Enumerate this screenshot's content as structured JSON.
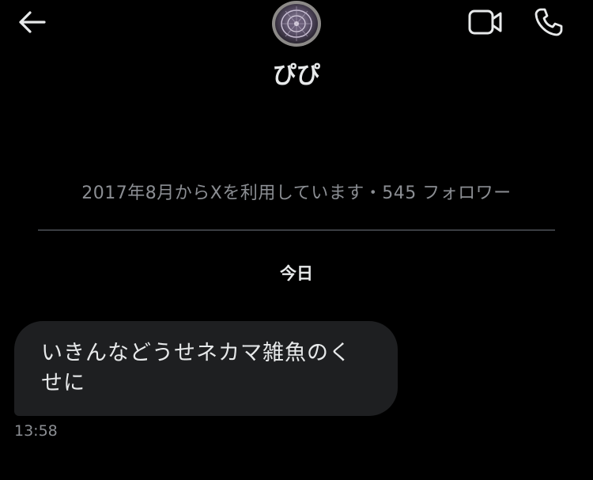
{
  "header": {
    "display_name": "ぴぴ"
  },
  "profile": {
    "info": "2017年8月からXを利用しています・545 フォロワー"
  },
  "conversation": {
    "date_label": "今日",
    "messages": [
      {
        "text": "いきんなどうせネカマ雑魚のくせに",
        "time": "13:58"
      }
    ]
  },
  "icons": {
    "back": "back-arrow-icon",
    "video": "video-camera-icon",
    "call": "phone-icon"
  },
  "colors": {
    "background": "#000000",
    "primary_text": "#e7e9ea",
    "secondary_text": "#8b8e93",
    "bubble": "#1e1f21",
    "divider": "#3a3d42"
  }
}
